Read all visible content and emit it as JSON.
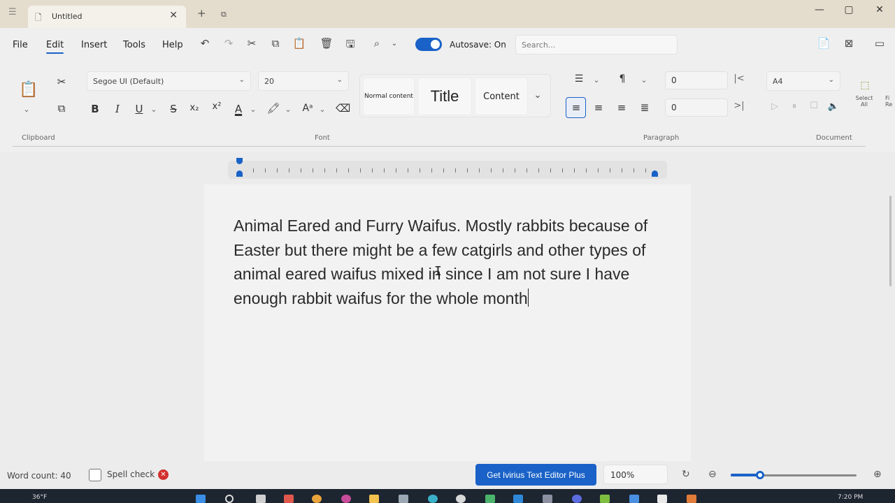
{
  "window": {
    "tab_title": "Untitled",
    "icons": {
      "app": "app-menu-icon",
      "doc": "document-icon",
      "close": "close-icon",
      "add": "plus-icon",
      "manage": "tab-manage-icon"
    },
    "controls": {
      "minimize": "—",
      "maximize": "▢",
      "close": "✕"
    }
  },
  "menu": {
    "items": [
      "File",
      "Edit",
      "Insert",
      "Tools",
      "Help"
    ],
    "active": "Edit",
    "autosave_label": "Autosave: On",
    "search_placeholder": "Search..."
  },
  "ribbon": {
    "groups": {
      "clipboard": "Clipboard",
      "font": "Font",
      "paragraph": "Paragraph",
      "document": "Document"
    },
    "font_name": "Segoe UI (Default)",
    "font_size": "20",
    "styles": {
      "normal": "Normal content",
      "title": "Title",
      "content": "Content"
    },
    "indent_left": "0",
    "indent_right": "0",
    "page_size": "A4",
    "select_all": "Select All",
    "find_replace_partial": "Fi Re"
  },
  "document": {
    "text": "Animal Eared and Furry Waifus. Mostly rabbits because of Easter but there might be a few catgirls and other types of animal eared waifus mixed in since I am not sure I have enough rabbit waifus for the whole month"
  },
  "status": {
    "word_count": "Word count: 40",
    "spell_check_label": "Spell check",
    "upgrade_button": "Get Ivirius Text Editor Plus",
    "zoom": "100%",
    "zoom_level": 0.23
  },
  "taskbar": {
    "weather": "36°F",
    "time": "7:20 PM",
    "accent": "#1a62c7"
  }
}
